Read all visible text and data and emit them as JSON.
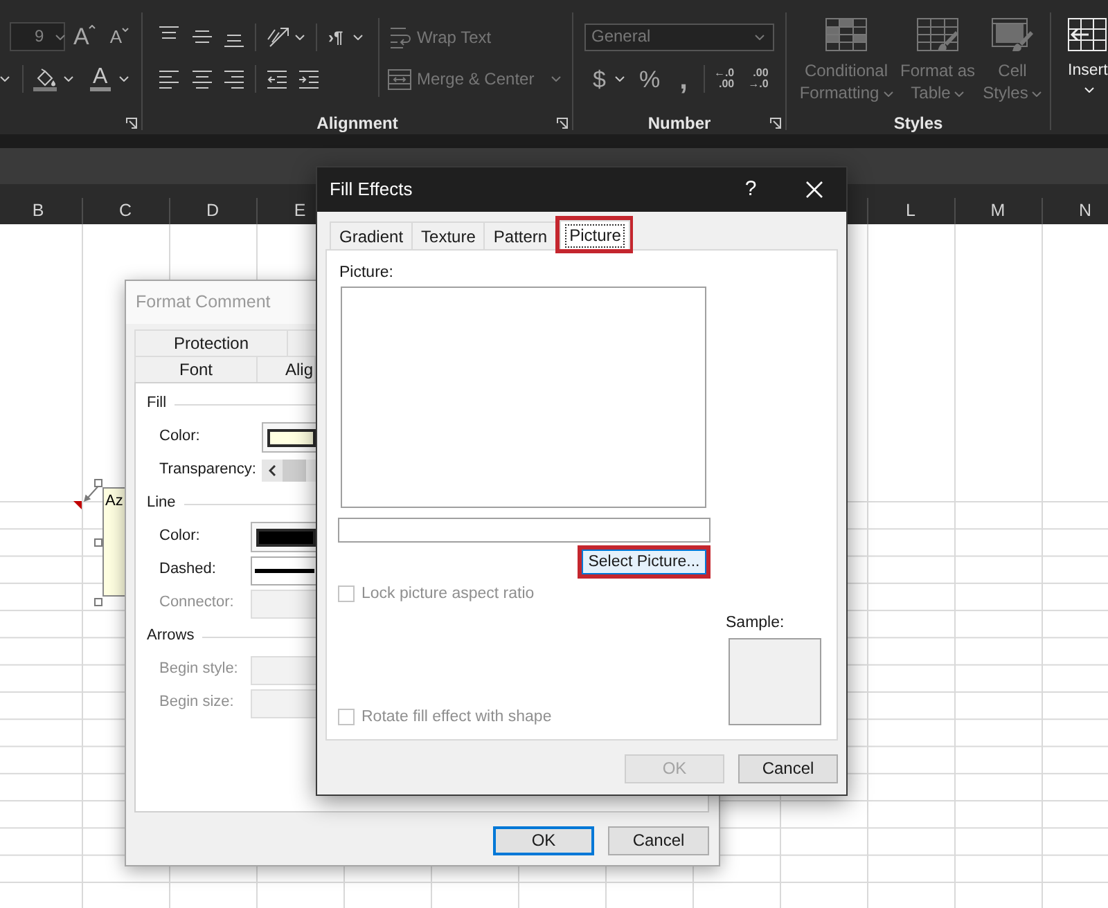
{
  "ribbon": {
    "font_group": {
      "font_size": "9",
      "grow_font": "A",
      "shrink_font": "A",
      "font_color": "A"
    },
    "alignment_group": {
      "label": "Alignment",
      "text_direction": "›¶",
      "wrap_text": {
        "label": "Wrap Text",
        "disabled": true
      },
      "merge_center": {
        "label": "Merge & Center",
        "disabled": true
      }
    },
    "number_group": {
      "label": "Number",
      "format": {
        "value": "General",
        "disabled": true
      },
      "currency": "$",
      "percent": "%",
      "comma": ",",
      "increase_decimal": [
        "←.0",
        ".00"
      ],
      "decrease_decimal": [
        ".00",
        "→.0"
      ]
    },
    "styles_group": {
      "label": "Styles",
      "buttons": [
        {
          "kind": "conditional",
          "label": "Conditional Formatting",
          "disabled": true
        },
        {
          "kind": "table",
          "label": "Format as Table",
          "disabled": true
        },
        {
          "kind": "cell_styles",
          "label": "Cell Styles",
          "disabled": true
        }
      ]
    },
    "cells_group": {
      "insert": {
        "label": "Insert",
        "disabled": false
      }
    }
  },
  "sheet": {
    "column_headers": {
      "left": [
        "B",
        "C",
        "D",
        "E"
      ],
      "right": [
        "L",
        "M",
        "N"
      ]
    },
    "comment": {
      "text": "Az"
    }
  },
  "format_comment": {
    "title": "Format Comment",
    "active": false,
    "tab_rows": [
      {
        "tabs": [
          {
            "label": "Protection",
            "selected": false
          }
        ]
      },
      {
        "tabs": [
          {
            "label": "Font",
            "selected": false
          },
          {
            "label": "Alig",
            "selected": false
          }
        ]
      }
    ],
    "sections": [
      {
        "title": "Fill",
        "fields": [
          {
            "kind": "color",
            "label": "Color:",
            "color": "#ffffe1",
            "disabled": false
          },
          {
            "kind": "slider",
            "label": "Transparency:",
            "level": 0,
            "disabled": false
          }
        ]
      },
      {
        "title": "Line",
        "fields": [
          {
            "kind": "color",
            "label": "Color:",
            "color": "#000000",
            "disabled": false
          },
          {
            "kind": "line_style",
            "label": "Dashed:",
            "disabled": false
          },
          {
            "kind": "dropdown",
            "label": "Connector:",
            "disabled": true
          }
        ]
      },
      {
        "title": "Arrows",
        "fields": [
          {
            "kind": "dropdown",
            "label": "Begin style:",
            "disabled": true
          },
          {
            "kind": "dropdown",
            "label": "Begin size:",
            "disabled": true
          }
        ]
      }
    ],
    "buttons": [
      {
        "label": "OK",
        "default": true
      },
      {
        "label": "Cancel",
        "default": false
      }
    ]
  },
  "fill_effects": {
    "title": "Fill Effects",
    "active": true,
    "help": "?",
    "tabs": [
      {
        "label": "Gradient",
        "selected": false,
        "highlighted": false
      },
      {
        "label": "Texture",
        "selected": false,
        "highlighted": false
      },
      {
        "label": "Pattern",
        "selected": false,
        "highlighted": false
      },
      {
        "label": "Picture",
        "selected": true,
        "highlighted": true
      }
    ],
    "picture_label": "Picture:",
    "select_button": {
      "label": "Select Picture...",
      "highlighted": true
    },
    "lock_aspect": {
      "label": "Lock picture aspect ratio",
      "checked": false,
      "disabled": true
    },
    "rotate_with_shape": {
      "label": "Rotate fill effect with shape",
      "checked": false,
      "disabled": true
    },
    "sample_label": "Sample:",
    "buttons": [
      {
        "label": "OK",
        "disabled": true
      },
      {
        "label": "Cancel",
        "disabled": false
      }
    ]
  }
}
